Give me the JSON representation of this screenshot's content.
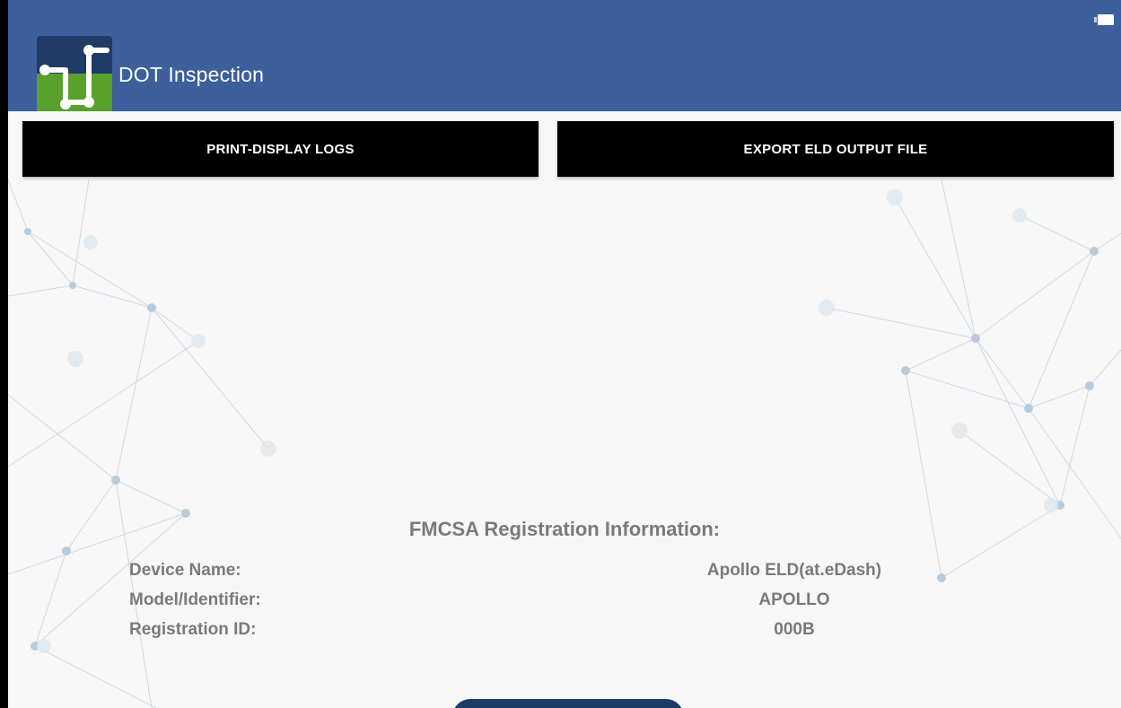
{
  "app_bar": {
    "title": "DOT Inspection",
    "logo_icon": "app-logo-icon",
    "battery_icon": "battery-icon",
    "background_color": "#3d5f9c"
  },
  "actions": {
    "print_label": "PRINT-DISPLAY LOGS",
    "export_label": "EXPORT ELD OUTPUT FILE"
  },
  "registration": {
    "heading": "FMCSA Registration Information:",
    "rows": [
      {
        "label": "Device Name:",
        "value": "Apollo ELD(at.eDash)"
      },
      {
        "label": "Model/Identifier:",
        "value": "APOLLO"
      },
      {
        "label": "Registration ID:",
        "value": "000B"
      }
    ]
  },
  "colors": {
    "accent": "#3d5f9c",
    "logo_green": "#5aa02c",
    "logo_navy": "#1f3b66",
    "button_bg": "#000000",
    "text_gray": "#7a7a7a"
  }
}
